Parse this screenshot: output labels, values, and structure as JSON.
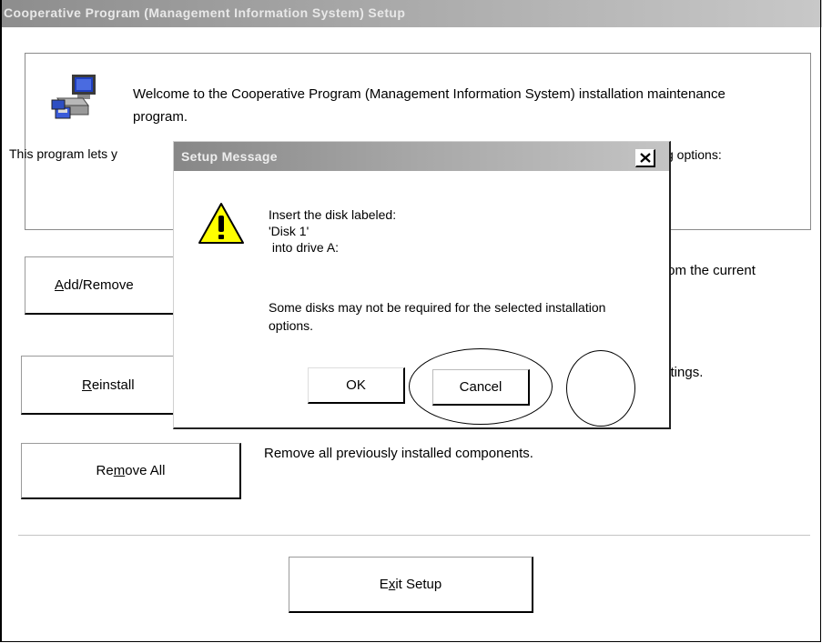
{
  "window": {
    "title": "Cooperative Program (Management Information System) Setup"
  },
  "welcome": {
    "text": "Welcome to the Cooperative Program (Management Information System) installation maintenance program.",
    "program_lets": "This program lets y",
    "options_fragment": "g options:"
  },
  "buttons": {
    "add_remove": {
      "pre": "",
      "accel": "A",
      "post": "dd/Remove"
    },
    "reinstall": {
      "pre": "",
      "accel": "R",
      "post": "einstall"
    },
    "remove_all": {
      "pre": "Re",
      "accel": "m",
      "post": "ove All"
    },
    "exit_setup": {
      "pre": "E",
      "accel": "x",
      "post": "it Setup"
    }
  },
  "descriptions": {
    "add_remove": "from the current",
    "reinstall": "ettings.",
    "remove_all": "Remove all previously installed components."
  },
  "dialog": {
    "title": "Setup Message",
    "close_label": "X",
    "message_lines": [
      "Insert the disk labeled:",
      "'Disk 1'",
      " into drive A:"
    ],
    "note": "Some disks may not be required for the selected installation options.",
    "ok_label": "OK",
    "cancel_label": "Cancel"
  },
  "icons": {
    "computer": "computer-setup-icon",
    "warning": "warning-icon",
    "close": "close-icon"
  },
  "colors": {
    "titlebar": "#a5a5a5",
    "warning_fill": "#ffff00"
  }
}
